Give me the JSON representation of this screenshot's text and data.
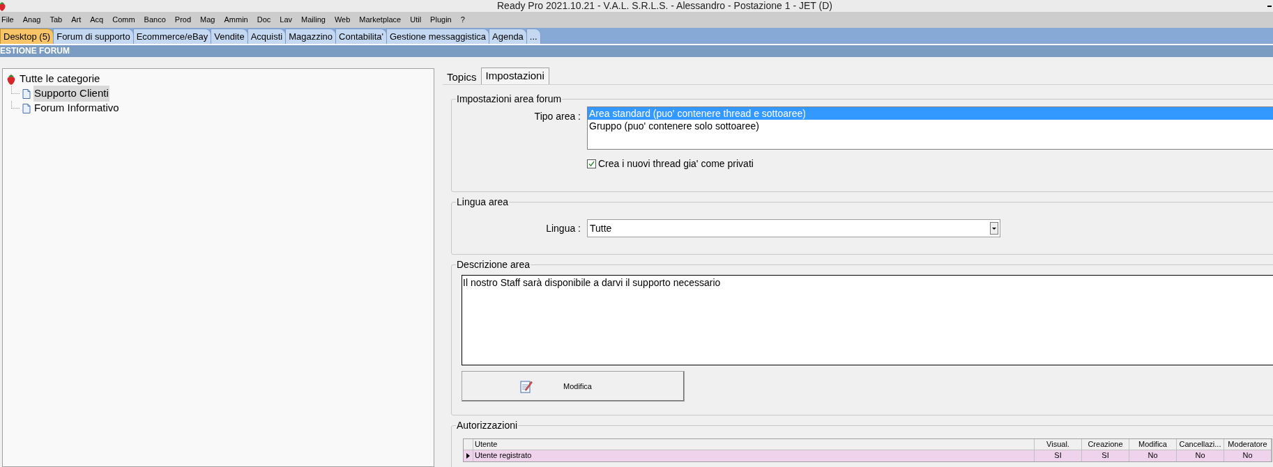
{
  "window": {
    "title": "Ready Pro 2021.10.21 - V.A.L. S.R.L.S. - Alessandro - Postazione 1 - JET (D)"
  },
  "menu": [
    "File",
    "Anag",
    "Tab",
    "Art",
    "Acq",
    "Comm",
    "Banco",
    "Prod",
    "Mag",
    "Ammin",
    "Doc",
    "Lav",
    "Mailing",
    "Web",
    "Marketplace",
    "Util",
    "Plugin",
    "?"
  ],
  "tabs": [
    {
      "label": "Desktop (5)",
      "selected": true
    },
    {
      "label": "Forum di supporto",
      "selected": false
    },
    {
      "label": "Ecommerce/eBay",
      "selected": false
    },
    {
      "label": "Vendite",
      "selected": false
    },
    {
      "label": "Acquisti",
      "selected": false
    },
    {
      "label": "Magazzino",
      "selected": false
    },
    {
      "label": "Contabilita'",
      "selected": false
    },
    {
      "label": "Gestione messaggistica",
      "selected": false
    },
    {
      "label": "Agenda",
      "selected": false
    },
    {
      "label": "...",
      "selected": false
    }
  ],
  "section_title": "ESTIONE FORUM",
  "tree": {
    "label": "Tutte le categorie",
    "selected": false,
    "children": [
      {
        "label": "Supporto Clienti",
        "selected": true
      },
      {
        "label": "Forum Informativo",
        "selected": false
      }
    ]
  },
  "detail_tabs": [
    {
      "label": "Topics",
      "selected": false
    },
    {
      "label": "Impostazioni",
      "selected": true
    }
  ],
  "area_settings": {
    "title": "Impostazioni area forum",
    "type_label": "Tipo area :",
    "type_options": [
      {
        "label": "Area standard (puo' contenere thread e sottoaree)",
        "selected": true
      },
      {
        "label": "Gruppo (puo' contenere solo sottoaree)",
        "selected": false
      }
    ],
    "private_threads": {
      "label": "Crea i nuovi thread gia' come privati",
      "checked": true
    }
  },
  "language": {
    "title": "Lingua area",
    "label": "Lingua :",
    "value": "Tutte"
  },
  "description": {
    "title": "Descrizione area",
    "value": "Il nostro Staff sarà disponibile a darvi il supporto necessario"
  },
  "modify_button": "Modifica",
  "authorizations": {
    "title": "Autorizzazioni",
    "columns": [
      "Utente",
      "Visual.",
      "Creazione",
      "Modifica",
      "Cancellazi...",
      "Moderatore"
    ],
    "rows": [
      {
        "selected": true,
        "cells": [
          "Utente registrato",
          "SI",
          "SI",
          "No",
          "No",
          "No"
        ]
      }
    ]
  }
}
